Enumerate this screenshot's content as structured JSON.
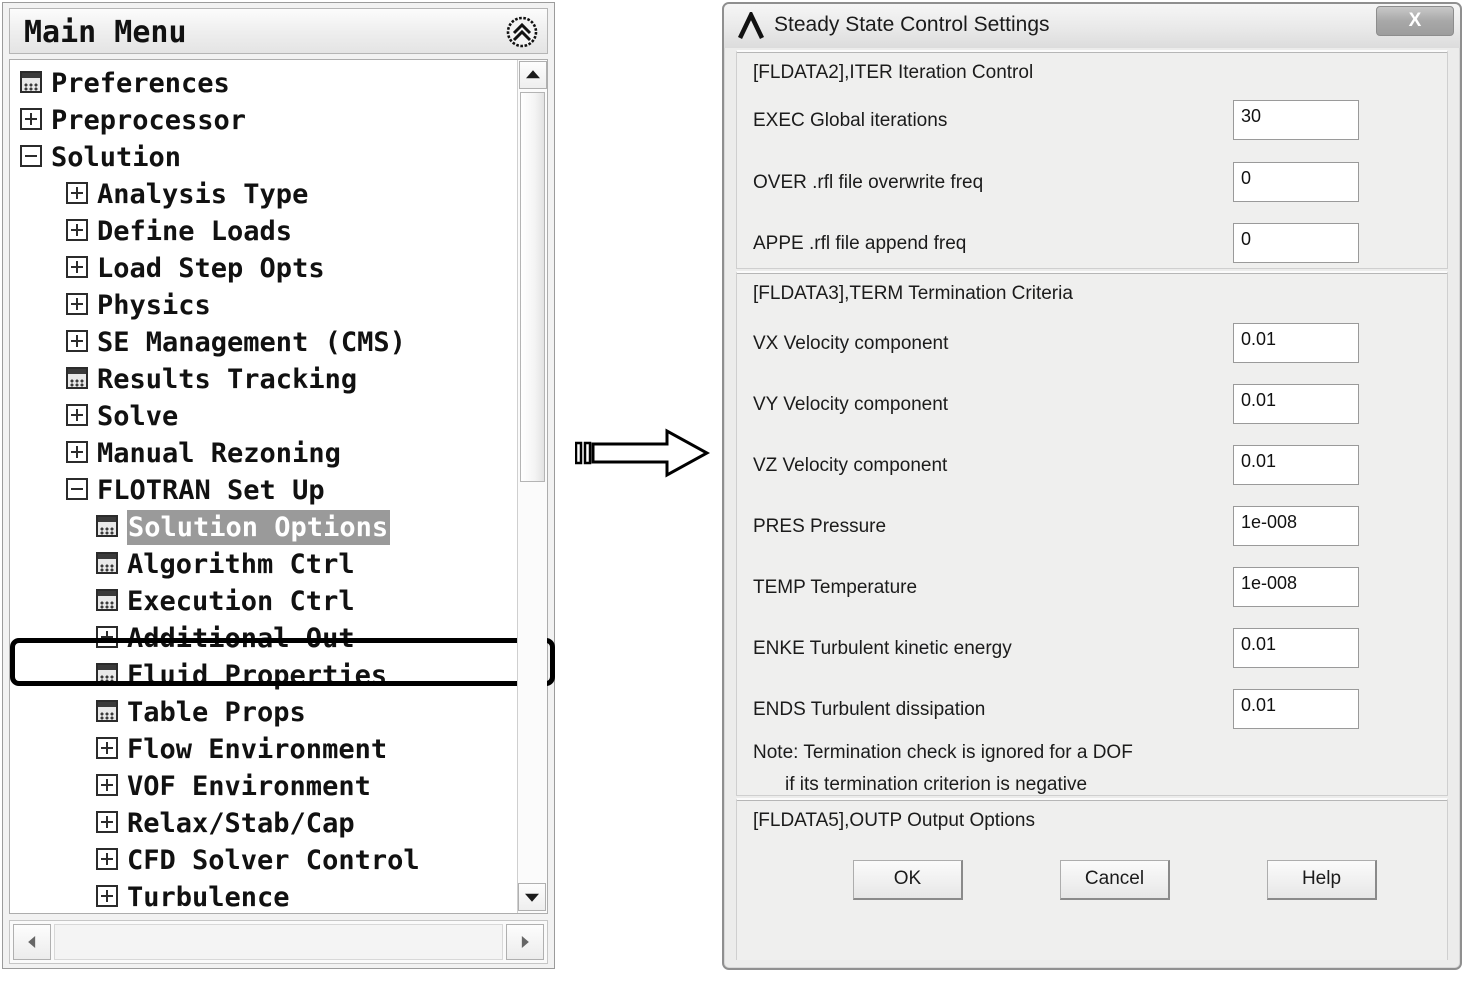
{
  "main_menu": {
    "title": "Main Menu",
    "collapse_icon": "double-chevron-up-icon",
    "tree": [
      {
        "label": "Preferences",
        "depth": 0,
        "icon": "leaf"
      },
      {
        "label": "Preprocessor",
        "depth": 0,
        "icon": "plus"
      },
      {
        "label": "Solution",
        "depth": 0,
        "icon": "minus"
      },
      {
        "label": "Analysis Type",
        "depth": 1,
        "icon": "plus"
      },
      {
        "label": "Define Loads",
        "depth": 1,
        "icon": "plus"
      },
      {
        "label": "Load Step Opts",
        "depth": 1,
        "icon": "plus"
      },
      {
        "label": "Physics",
        "depth": 1,
        "icon": "plus"
      },
      {
        "label": "SE Management (CMS)",
        "depth": 1,
        "icon": "plus"
      },
      {
        "label": "Results Tracking",
        "depth": 1,
        "icon": "leaf"
      },
      {
        "label": "Solve",
        "depth": 1,
        "icon": "plus"
      },
      {
        "label": "Manual Rezoning",
        "depth": 1,
        "icon": "plus"
      },
      {
        "label": "FLOTRAN Set Up",
        "depth": 1,
        "icon": "minus"
      },
      {
        "label": "Solution Options",
        "depth": 2,
        "icon": "leaf",
        "selected": true
      },
      {
        "label": "Algorithm Ctrl",
        "depth": 2,
        "icon": "leaf"
      },
      {
        "label": "Execution Ctrl",
        "depth": 2,
        "icon": "leaf",
        "annotated": true
      },
      {
        "label": "Additional Out",
        "depth": 2,
        "icon": "plus"
      },
      {
        "label": "Fluid Properties",
        "depth": 2,
        "icon": "leaf"
      },
      {
        "label": "Table Props",
        "depth": 2,
        "icon": "leaf"
      },
      {
        "label": "Flow Environment",
        "depth": 2,
        "icon": "plus"
      },
      {
        "label": "VOF Environment",
        "depth": 2,
        "icon": "plus"
      },
      {
        "label": "Relax/Stab/Cap",
        "depth": 2,
        "icon": "plus"
      },
      {
        "label": "CFD Solver Control",
        "depth": 2,
        "icon": "plus"
      },
      {
        "label": "Turbulence",
        "depth": 2,
        "icon": "plus"
      }
    ]
  },
  "annotation": {
    "arrow_icon": "right-arrow-annotation"
  },
  "dialog": {
    "title": "Steady State Control Settings",
    "logo_icon": "ansys-lambda-logo-icon",
    "close_label": "X",
    "sections": [
      {
        "heading": "[FLDATA2],ITER   Iteration Control",
        "fields": [
          {
            "label": "EXEC  Global iterations",
            "value": "30"
          },
          {
            "label": "OVER  .rfl file overwrite freq",
            "value": "0"
          },
          {
            "label": "APPE  .rfl file append freq",
            "value": "0"
          }
        ]
      },
      {
        "heading": "[FLDATA3],TERM   Termination Criteria",
        "fields": [
          {
            "label": "VX    Velocity component",
            "value": "0.01"
          },
          {
            "label": "VY    Velocity component",
            "value": "0.01"
          },
          {
            "label": "VZ    Velocity component",
            "value": "0.01"
          },
          {
            "label": "PRES  Pressure",
            "value": "1e-008"
          },
          {
            "label": "TEMP  Temperature",
            "value": "1e-008"
          },
          {
            "label": "ENKE  Turbulent kinetic energy",
            "value": "0.01"
          },
          {
            "label": "ENDS  Turbulent dissipation",
            "value": "0.01"
          }
        ],
        "note_line1": "Note:  Termination check is ignored for a DOF",
        "note_line2": "if its termination criterion is negative"
      },
      {
        "heading": "[FLDATA5],OUTP   Output Options",
        "fields": []
      }
    ],
    "buttons": [
      {
        "label": "OK"
      },
      {
        "label": "Cancel"
      },
      {
        "label": "Help"
      }
    ]
  }
}
